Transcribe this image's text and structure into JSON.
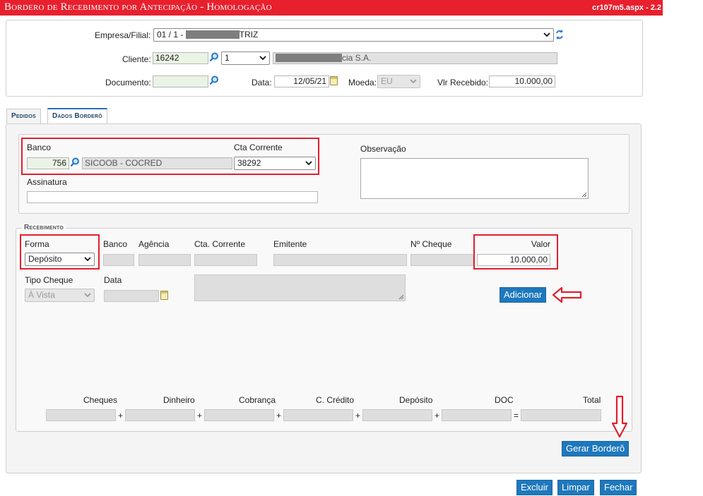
{
  "title": {
    "left": "Bordero de Recebimento por Antecipação  - Homologação",
    "right": "cr107m5.aspx - 2.2"
  },
  "header": {
    "empresa_label": "Empresa/Filial:",
    "empresa_prefix": "01 / 1 - ",
    "empresa_suffix": "TRIZ",
    "cliente_label": "Cliente:",
    "cliente_code": "16242",
    "cliente_seq": "1",
    "cliente_name_suffix": "cia S.A.",
    "documento_label": "Documento:",
    "documento_value": "",
    "data_label": "Data:",
    "data_value": "12/05/21",
    "moeda_label": "Moeda:",
    "moeda_value": "EU",
    "vlr_label": "Vlr Recebido:",
    "vlr_value": "10.000,00"
  },
  "tabs": [
    {
      "label": "Pedidos",
      "active": false
    },
    {
      "label": "Dados Borderô",
      "active": true
    }
  ],
  "dados": {
    "banco_label": "Banco",
    "banco_code": "756",
    "banco_name": "SICOOB - COCRED",
    "cta_label": "Cta Corrente",
    "cta_value": "38292",
    "obs_label": "Observação",
    "assinatura_label": "Assinatura",
    "assinatura_value": ""
  },
  "recebimento": {
    "legend": "Recebimento",
    "forma_label": "Forma",
    "forma_value": "Depósito",
    "banco_label": "Banco",
    "agencia_label": "Agência",
    "cta_label": "Cta. Corrente",
    "emitente_label": "Emitente",
    "cheque_label": "Nº Cheque",
    "valor_label": "Valor",
    "valor_value": "10.000,00",
    "tipo_cheque_label": "Tipo Cheque",
    "tipo_cheque_value": "À Vista",
    "data_label": "Data",
    "adicionar_label": "Adicionar"
  },
  "totals": {
    "labels": [
      "Cheques",
      "Dinheiro",
      "Cobrança",
      "C. Crédito",
      "Depósito",
      "DOC",
      "Total"
    ],
    "plus": "+",
    "equals": "="
  },
  "actions": {
    "gerar_label": "Gerar Borderô",
    "excluir_label": "Excluir",
    "limpar_label": "Limpar",
    "fechar_label": "Fechar"
  },
  "colors": {
    "title_bar": "#e8202e",
    "button": "#1e78bd",
    "highlight": "#e0202e"
  }
}
